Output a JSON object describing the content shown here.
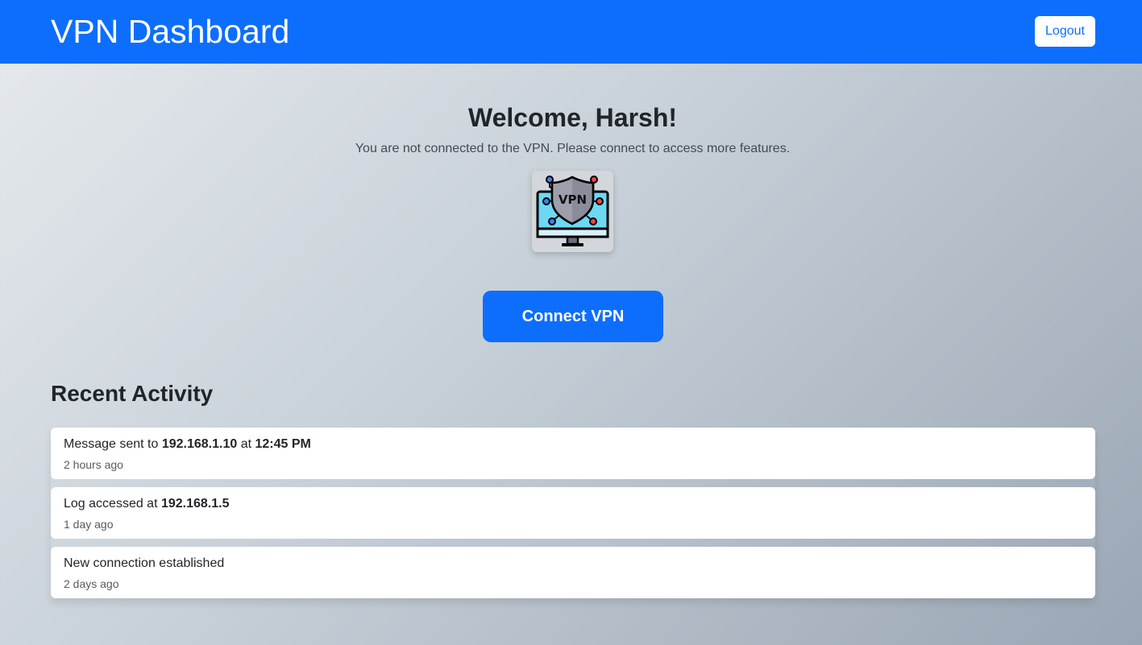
{
  "header": {
    "brand": "VPN Dashboard",
    "logout_label": "Logout"
  },
  "welcome": {
    "title": "Welcome, Harsh!",
    "message": "You are not connected to the VPN. Please connect to access more features.",
    "logo_icon": "vpn-shield-monitor-icon",
    "logo_text": "VPN"
  },
  "connect_label": "Connect VPN",
  "activity": {
    "title": "Recent Activity",
    "items": [
      {
        "parts": [
          "Message sent to ",
          "192.168.1.10",
          " at ",
          "12:45 PM"
        ],
        "time": "2 hours ago"
      },
      {
        "parts": [
          "Log accessed at ",
          "192.168.1.5"
        ],
        "time": "1 day ago"
      },
      {
        "parts": [
          "New connection established"
        ],
        "time": "2 days ago"
      }
    ]
  },
  "colors": {
    "primary": "#0d6efd",
    "background_start": "#e6eaed",
    "background_end": "#9aa6b4"
  }
}
